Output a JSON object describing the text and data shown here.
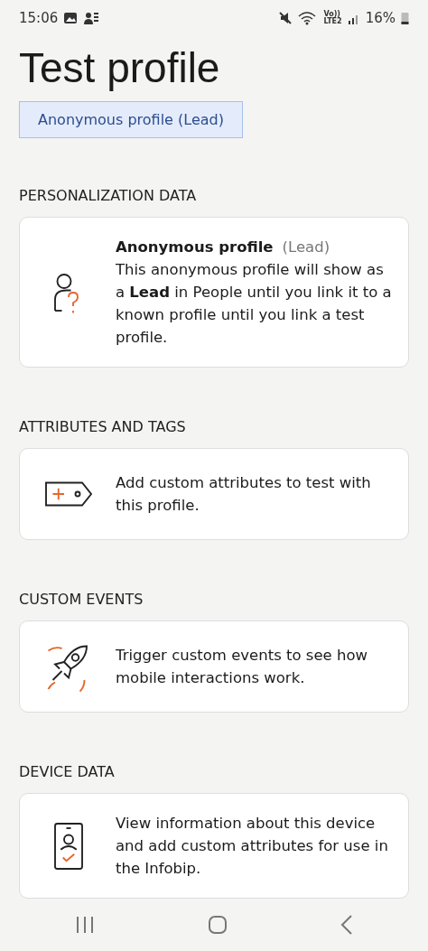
{
  "status_bar": {
    "time": "15:06",
    "network_top": "Vo))",
    "network_bottom": "LTE2",
    "battery": "16%"
  },
  "title": "Test profile",
  "profile_badge": "Anonymous profile (Lead)",
  "sections": [
    {
      "heading": "PERSONALIZATION DATA",
      "kind": "profile",
      "card": {
        "title": "Anonymous profile",
        "tag": "(Lead)",
        "text": "This anonymous profile will show as a **Lead** in People until you link it to a known profile until you link a test profile."
      }
    },
    {
      "heading": "ATTRIBUTES AND TAGS",
      "kind": "tag",
      "card": {
        "text": "Add custom attributes to test with this profile."
      }
    },
    {
      "heading": "CUSTOM EVENTS",
      "kind": "rocket",
      "card": {
        "text": "Trigger custom events to see how mobile interactions work."
      }
    },
    {
      "heading": "DEVICE DATA",
      "kind": "device",
      "card": {
        "text": "View information about this device and add custom attributes for use in the Infobip."
      }
    }
  ]
}
